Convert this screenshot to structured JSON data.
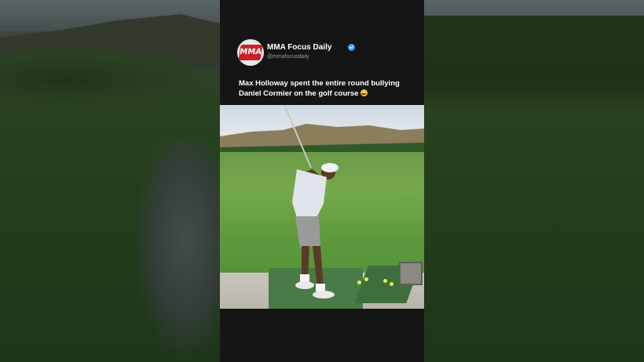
{
  "post": {
    "account_name": "MMA Focus Daily",
    "account_handle": "@mmafocusdaily",
    "avatar_text": "MMA",
    "caption": "Max Holloway spent the entire round bullying Daniel Cormier on the golf course",
    "verified_color": "#3b9ef0",
    "emoji": "laughing-crying-emoji-icon"
  },
  "colors": {
    "panel_background": "#151515",
    "brand_red": "#c7202a"
  }
}
